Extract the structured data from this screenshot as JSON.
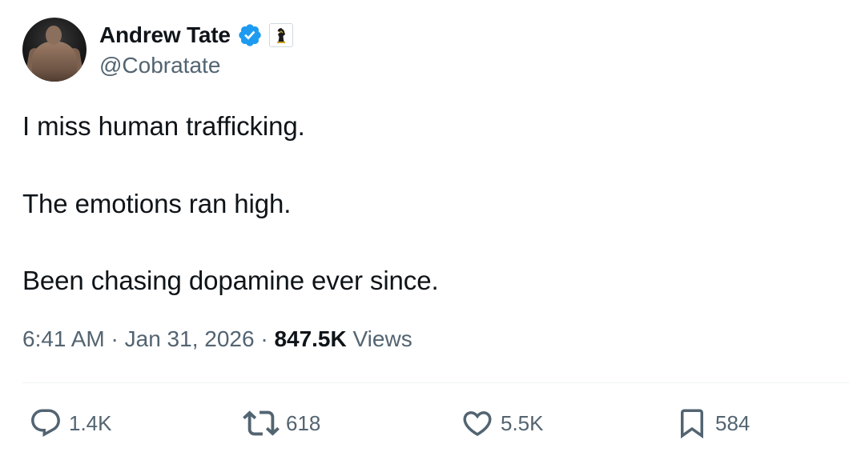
{
  "author": {
    "display_name": "Andrew Tate",
    "handle": "@Cobratate",
    "verified_color": "#1d9bf0",
    "avatar_icon": "profile-photo"
  },
  "tweet": {
    "lines": [
      "I miss human trafficking.",
      "The emotions ran high.",
      "Been chasing dopamine ever since."
    ]
  },
  "meta": {
    "time": "6:41 AM",
    "separator": "·",
    "date": "Jan 31, 2026",
    "views_count": "847.5K",
    "views_label": "Views"
  },
  "actions": {
    "replies": "1.4K",
    "reposts": "618",
    "likes": "5.5K",
    "bookmarks": "584"
  },
  "colors": {
    "text": "#0f1419",
    "secondary": "#536471",
    "divider": "#eff3f4"
  }
}
